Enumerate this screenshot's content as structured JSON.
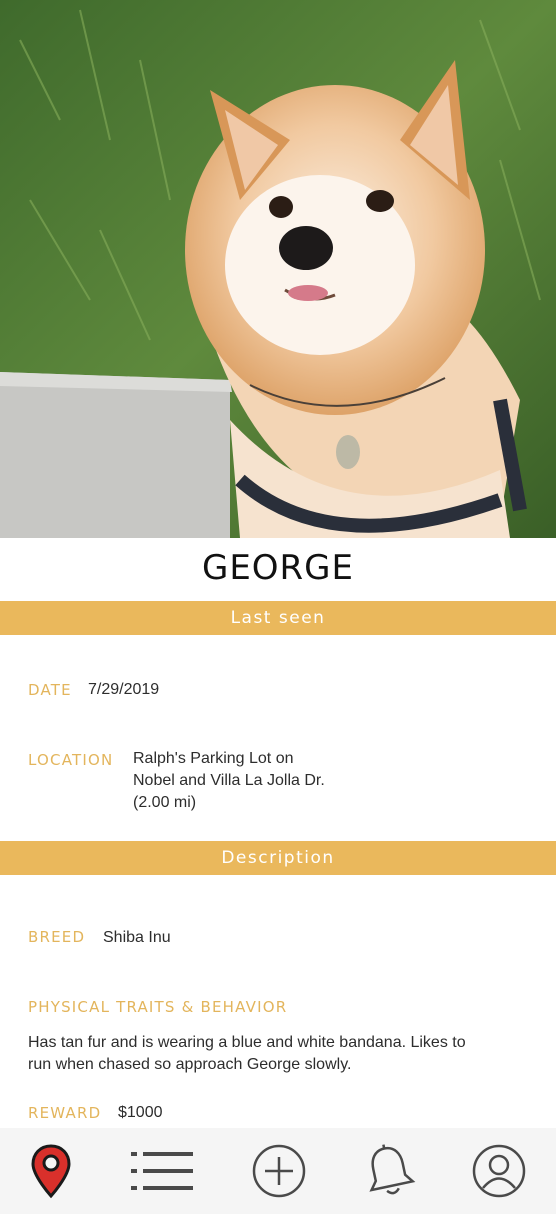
{
  "pet": {
    "name": "GEORGE"
  },
  "sections": {
    "last_seen": "Last seen",
    "description": "Description"
  },
  "last_seen": {
    "date_label": "DATE",
    "date": "7/29/2019",
    "location_label": "LOCATION",
    "location_lines": [
      "Ralph's Parking Lot on",
      "Nobel and Villa La Jolla Dr.",
      "(2.00 mi)"
    ]
  },
  "description": {
    "breed_label": "BREED",
    "breed": "Shiba Inu",
    "traits_label": "PHYSICAL TRAITS & BEHAVIOR",
    "traits_lines": [
      "Has tan fur and is wearing a blue and white bandana. Likes to",
      "run when chased so approach George slowly."
    ],
    "reward_label": "REWARD",
    "reward": "$1000"
  },
  "nav": {
    "items": [
      {
        "icon": "map-pin-icon",
        "active": true
      },
      {
        "icon": "list-icon",
        "active": false
      },
      {
        "icon": "add-circle-icon",
        "active": false
      },
      {
        "icon": "bell-icon",
        "active": false
      },
      {
        "icon": "profile-icon",
        "active": false
      }
    ],
    "active_color": "#d9302b",
    "inactive_color": "#4a4a4a"
  },
  "colors": {
    "accent": "#eab85c",
    "label": "#e3b55c"
  }
}
